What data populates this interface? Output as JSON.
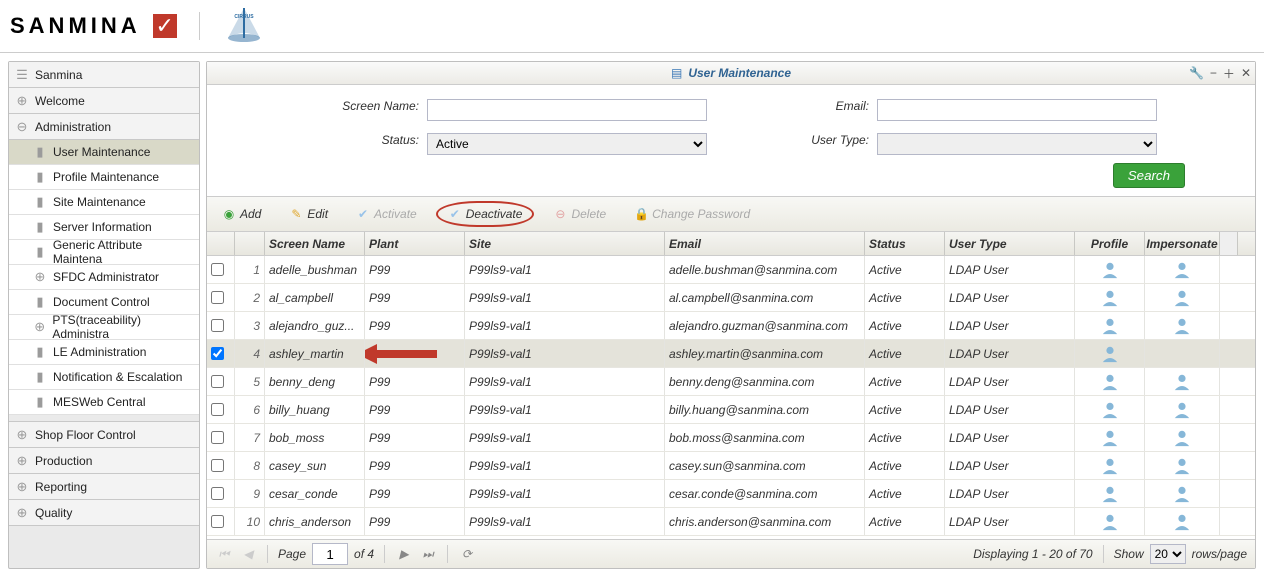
{
  "brand": {
    "name": "SANMINA",
    "product": "CIRRUS",
    "list_icon_label": "Sanmina"
  },
  "nav": {
    "welcome": "Welcome",
    "administration": "Administration",
    "admin_children": [
      "User Maintenance",
      "Profile Maintenance",
      "Site Maintenance",
      "Server Information",
      "Generic Attribute Maintena",
      "SFDC Administrator",
      "Document Control",
      "PTS(traceability) Administra",
      "LE Administration",
      "Notification & Escalation",
      "MESWeb Central"
    ],
    "shop_floor": "Shop Floor Control",
    "production": "Production",
    "reporting": "Reporting",
    "quality": "Quality"
  },
  "panel": {
    "title": "User Maintenance"
  },
  "search": {
    "screen_name_label": "Screen Name:",
    "screen_name_value": "",
    "email_label": "Email:",
    "email_value": "",
    "status_label": "Status:",
    "status_value": "Active",
    "user_type_label": "User Type:",
    "user_type_value": "",
    "button": "Search"
  },
  "toolbar": {
    "add": "Add",
    "edit": "Edit",
    "activate": "Activate",
    "deactivate": "Deactivate",
    "delete": "Delete",
    "change_pw": "Change Password"
  },
  "grid": {
    "headers": {
      "screen_name": "Screen Name",
      "plant": "Plant",
      "site": "Site",
      "email": "Email",
      "status": "Status",
      "user_type": "User Type",
      "profile": "Profile",
      "impersonate": "Impersonate"
    },
    "rows": [
      {
        "n": 1,
        "checked": false,
        "screen": "adelle_bushman",
        "plant": "P99",
        "site": "P99ls9-val1",
        "email": "adelle.bushman@sanmina.com",
        "status": "Active",
        "utype": "LDAP User",
        "hasImpersonate": true
      },
      {
        "n": 2,
        "checked": false,
        "screen": "al_campbell",
        "plant": "P99",
        "site": "P99ls9-val1",
        "email": "al.campbell@sanmina.com",
        "status": "Active",
        "utype": "LDAP User",
        "hasImpersonate": true
      },
      {
        "n": 3,
        "checked": false,
        "screen": "alejandro_guz...",
        "plant": "P99",
        "site": "P99ls9-val1",
        "email": "alejandro.guzman@sanmina.com",
        "status": "Active",
        "utype": "LDAP User",
        "hasImpersonate": true
      },
      {
        "n": 4,
        "checked": true,
        "screen": "ashley_martin",
        "plant": "",
        "site": "P99ls9-val1",
        "email": "ashley.martin@sanmina.com",
        "status": "Active",
        "utype": "LDAP User",
        "hasImpersonate": false,
        "selected": true,
        "arrow": true
      },
      {
        "n": 5,
        "checked": false,
        "screen": "benny_deng",
        "plant": "P99",
        "site": "P99ls9-val1",
        "email": "benny.deng@sanmina.com",
        "status": "Active",
        "utype": "LDAP User",
        "hasImpersonate": true
      },
      {
        "n": 6,
        "checked": false,
        "screen": "billy_huang",
        "plant": "P99",
        "site": "P99ls9-val1",
        "email": "billy.huang@sanmina.com",
        "status": "Active",
        "utype": "LDAP User",
        "hasImpersonate": true
      },
      {
        "n": 7,
        "checked": false,
        "screen": "bob_moss",
        "plant": "P99",
        "site": "P99ls9-val1",
        "email": "bob.moss@sanmina.com",
        "status": "Active",
        "utype": "LDAP User",
        "hasImpersonate": true
      },
      {
        "n": 8,
        "checked": false,
        "screen": "casey_sun",
        "plant": "P99",
        "site": "P99ls9-val1",
        "email": "casey.sun@sanmina.com",
        "status": "Active",
        "utype": "LDAP User",
        "hasImpersonate": true
      },
      {
        "n": 9,
        "checked": false,
        "screen": "cesar_conde",
        "plant": "P99",
        "site": "P99ls9-val1",
        "email": "cesar.conde@sanmina.com",
        "status": "Active",
        "utype": "LDAP User",
        "hasImpersonate": true
      },
      {
        "n": 10,
        "checked": false,
        "screen": "chris_anderson",
        "plant": "P99",
        "site": "P99ls9-val1",
        "email": "chris.anderson@sanmina.com",
        "status": "Active",
        "utype": "LDAP User",
        "hasImpersonate": true
      }
    ]
  },
  "pager": {
    "page_label": "Page",
    "page": "1",
    "of_label": "of 4",
    "display": "Displaying 1 - 20 of 70",
    "show_label": "Show",
    "rows_per": "20",
    "rows_per_suffix": "rows/page"
  }
}
